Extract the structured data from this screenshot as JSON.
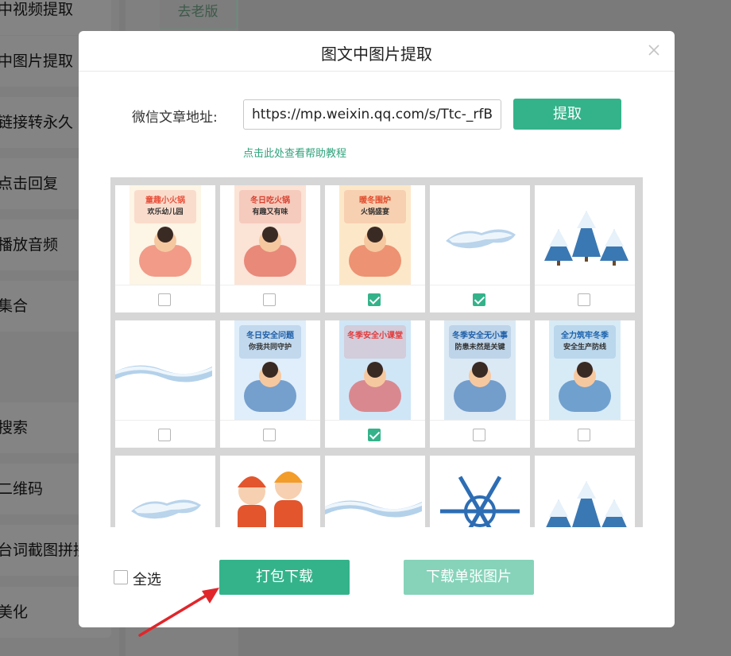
{
  "background": {
    "sidebar_items": [
      "文中视频提取",
      "文中图片提取",
      "图链接转永久",
      "息点击回复",
      "图播放音频",
      "文集合",
      "文搜索",
      "成二维码",
      "彩台词截图拼接",
      "图美化"
    ],
    "old_version_button": "去老版"
  },
  "modal": {
    "title": "图文中图片提取",
    "url_label": "微信文章地址:",
    "url_value": "https://mp.weixin.qq.com/s/Ttc-_rfB",
    "extract_button": "提取",
    "help_link": "点击此处查看帮助教程",
    "select_all_label": "全选",
    "pack_download_button": "打包下载",
    "single_download_button": "下载单张图片"
  },
  "images": [
    {
      "kind": "poster",
      "title": "童趣小火锅",
      "subtitle": "欢乐幼儿园",
      "checked": false
    },
    {
      "kind": "poster",
      "title": "冬日吃火锅",
      "subtitle": "有趣又有味",
      "checked": false
    },
    {
      "kind": "poster",
      "title": "暖冬围炉",
      "subtitle": "火锅盛宴",
      "checked": true
    },
    {
      "kind": "snow-cap",
      "checked": true
    },
    {
      "kind": "trees",
      "checked": false
    },
    {
      "kind": "snow-wave",
      "checked": false
    },
    {
      "kind": "poster",
      "title": "冬日安全问题",
      "subtitle": "你我共同守护",
      "checked": false
    },
    {
      "kind": "poster",
      "title": "冬季安全小课堂",
      "subtitle": "",
      "checked": true
    },
    {
      "kind": "poster",
      "title": "冬季安全无小事",
      "subtitle": "防患未然是关键",
      "checked": false
    },
    {
      "kind": "poster",
      "title": "全力筑牢冬季",
      "subtitle": "安全生产防线",
      "checked": false
    },
    {
      "kind": "snow-cap",
      "checked": false
    },
    {
      "kind": "kids",
      "checked": false
    },
    {
      "kind": "snow-wave",
      "checked": false
    },
    {
      "kind": "snowflake",
      "checked": false
    },
    {
      "kind": "trees",
      "checked": false
    }
  ],
  "colors": {
    "accent": "#34b38a",
    "accent_disabled": "#86d3ba",
    "overlay": "#7a7a7a",
    "arrow": "#e0262b"
  }
}
